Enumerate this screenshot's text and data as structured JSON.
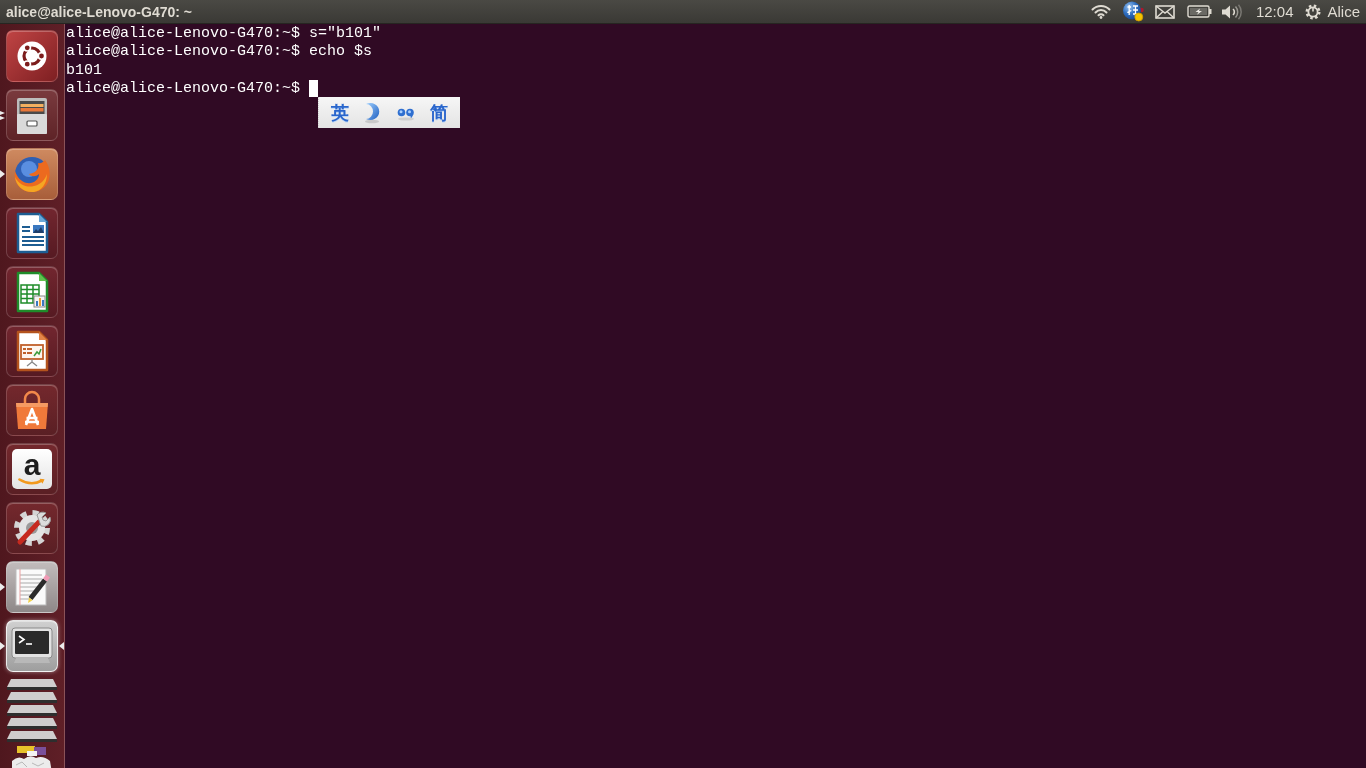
{
  "top_panel": {
    "title": "alice@alice-Lenovo-G470: ~",
    "clock": "12:04",
    "user": "Alice"
  },
  "launcher": {
    "items": [
      {
        "kind": "dash",
        "running": false,
        "several_windows": false,
        "focused": false
      },
      {
        "kind": "files",
        "running": true,
        "several_windows": true,
        "focused": false
      },
      {
        "kind": "browser",
        "running": true,
        "several_windows": false,
        "focused": false
      },
      {
        "kind": "writer",
        "running": false,
        "several_windows": false,
        "focused": false
      },
      {
        "kind": "calc",
        "running": false,
        "several_windows": false,
        "focused": false
      },
      {
        "kind": "impress",
        "running": false,
        "several_windows": false,
        "focused": false
      },
      {
        "kind": "store",
        "running": false,
        "several_windows": false,
        "focused": false
      },
      {
        "kind": "letter",
        "glyph": "a",
        "running": false,
        "several_windows": false,
        "focused": false
      },
      {
        "kind": "settings",
        "running": false,
        "several_windows": false,
        "focused": false
      },
      {
        "kind": "editor",
        "running": true,
        "several_windows": false,
        "focused": false
      },
      {
        "kind": "terminal",
        "running": true,
        "several_windows": false,
        "focused": true
      }
    ]
  },
  "terminal": {
    "lines": [
      {
        "text": "alice@alice-Lenovo-G470:~$ s=\"b101\"",
        "cursor": false
      },
      {
        "text": "alice@alice-Lenovo-G470:~$ echo $s",
        "cursor": false
      },
      {
        "text": "b101",
        "cursor": false
      },
      {
        "text": "alice@alice-Lenovo-G470:~$",
        "cursor": true
      }
    ]
  },
  "ime_toolbar": {
    "items": [
      {
        "kind": "text",
        "label": "英"
      },
      {
        "kind": "crescent"
      },
      {
        "kind": "dots"
      },
      {
        "kind": "text",
        "label": "简"
      }
    ]
  }
}
